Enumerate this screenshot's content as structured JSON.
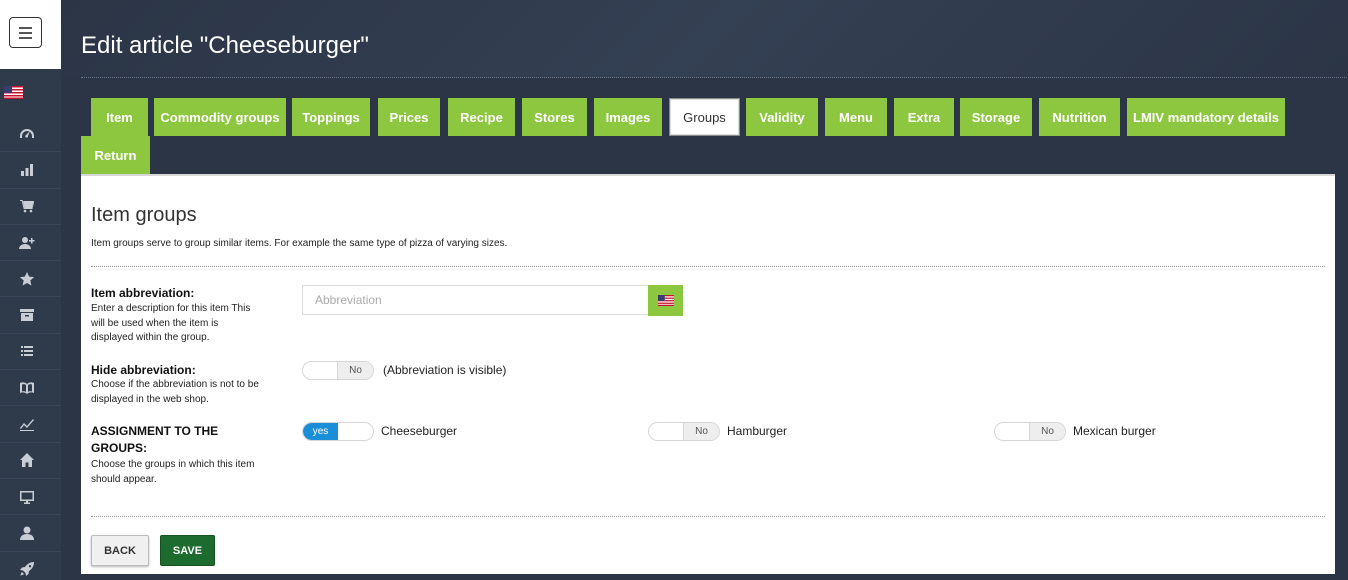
{
  "sidebar": {
    "menu_icon": "hamburger-menu-icon",
    "language_flag": "us-flag-icon",
    "icons": [
      "dashboard-gauge-icon",
      "bar-chart-icon",
      "shopping-cart-icon",
      "add-user-icon",
      "star-icon",
      "archive-icon",
      "list-icon",
      "book-icon",
      "trend-chart-icon",
      "home-icon",
      "monitor-icon",
      "user-icon",
      "rocket-icon"
    ]
  },
  "header": {
    "title": "Edit article \"Cheeseburger\""
  },
  "tabs": [
    {
      "label": "Item",
      "active": false
    },
    {
      "label": "Commodity groups",
      "active": false
    },
    {
      "label": "Toppings",
      "active": false
    },
    {
      "label": "Prices",
      "active": false
    },
    {
      "label": "Recipe",
      "active": false
    },
    {
      "label": "Stores",
      "active": false
    },
    {
      "label": "Images",
      "active": false
    },
    {
      "label": "Groups",
      "active": true
    },
    {
      "label": "Validity",
      "active": false
    },
    {
      "label": "Menu",
      "active": false
    },
    {
      "label": "Extra",
      "active": false
    },
    {
      "label": "Storage",
      "active": false
    },
    {
      "label": "Nutrition",
      "active": false
    },
    {
      "label": "LMIV mandatory details",
      "active": false
    },
    {
      "label": "Return",
      "active": false
    }
  ],
  "section": {
    "title": "Item groups",
    "description": "Item groups serve to group similar items. For example the same type of pizza of varying sizes."
  },
  "abbreviation": {
    "label": "Item abbreviation:",
    "help": "Enter a description for this item This will be used when the item is displayed within the group.",
    "placeholder": "Abbreviation",
    "value": ""
  },
  "hide_abbreviation": {
    "label": "Hide abbreviation:",
    "help": "Choose if the abbreviation is not to be displayed in the web shop.",
    "toggle_label": "No",
    "status_text": "(Abbreviation is visible)"
  },
  "assignment": {
    "label": "ASSIGNMENT TO THE GROUPS:",
    "help": "Choose the groups in which this item should appear.",
    "groups": [
      {
        "name": "Cheeseburger",
        "state": "yes"
      },
      {
        "name": "Hamburger",
        "state": "No"
      },
      {
        "name": "Mexican burger",
        "state": "No"
      }
    ]
  },
  "buttons": {
    "back": "BACK",
    "save": "SAVE"
  },
  "colors": {
    "tab_green": "#8dc63f",
    "save_green": "#1e6b2f",
    "toggle_blue": "#1a8fd8",
    "background_dark": "#2b3546"
  }
}
